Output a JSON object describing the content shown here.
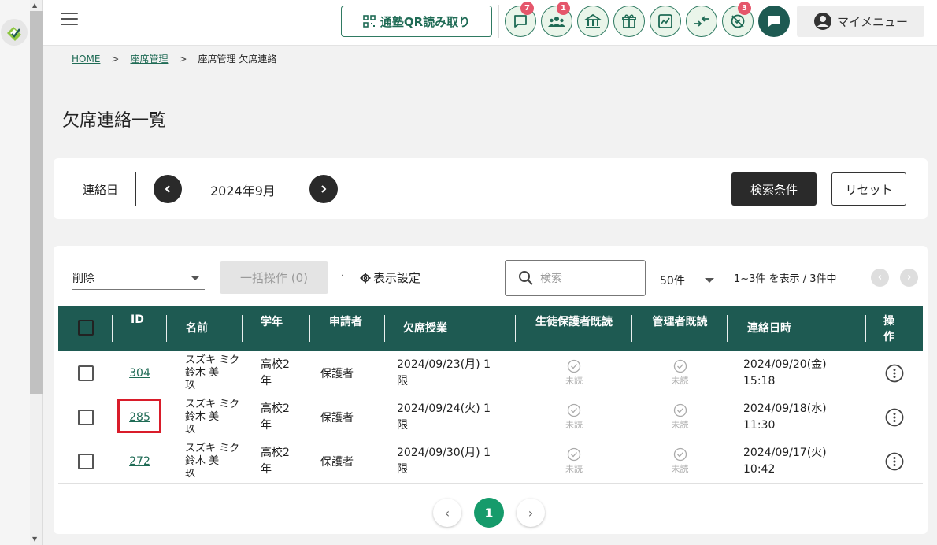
{
  "header": {
    "qr_label": "通塾QR読み取り",
    "badges": {
      "messages": "7",
      "students": "1",
      "alerts": "3"
    },
    "mymenu_label": "マイメニュー"
  },
  "breadcrumb": {
    "home": "HOME",
    "seat": "座席管理",
    "current": "座席管理 欠席連絡"
  },
  "page_title": "欠席連絡一覧",
  "filter": {
    "label": "連絡日",
    "month": "2024年9月",
    "search_condition_label": "検索条件",
    "reset_label": "リセット"
  },
  "toolbar": {
    "bulk_action_selected": "削除",
    "bulk_button_label": "一括操作 (0)",
    "display_settings_label": "表示設定",
    "search_placeholder": "検索",
    "per_page": "50件",
    "range_text": "1~3件 を表示 / 3件中"
  },
  "table": {
    "headers": {
      "id": "ID",
      "name": "名前",
      "grade": "学年",
      "applicant": "申請者",
      "absent_class": "欠席授業",
      "guardian_read": "生徒保護者既読",
      "admin_read": "管理者既読",
      "contact_datetime": "連絡日時",
      "actions": "操作"
    },
    "rows": [
      {
        "id": "304",
        "name_kana": "スズキ ミク",
        "name_line2": "鈴木 美",
        "name_line3": "玖",
        "grade_l1": "高校2",
        "grade_l2": "年",
        "applicant": "保護者",
        "class_l1": "2024/09/23(月) 1",
        "class_l2": "限",
        "guardian_read": "未読",
        "admin_read": "未読",
        "date_l1": "2024/09/20(金)",
        "date_l2": "15:18"
      },
      {
        "id": "285",
        "name_kana": "スズキ ミク",
        "name_line2": "鈴木 美",
        "name_line3": "玖",
        "grade_l1": "高校2",
        "grade_l2": "年",
        "applicant": "保護者",
        "class_l1": "2024/09/24(火) 1",
        "class_l2": "限",
        "guardian_read": "未読",
        "admin_read": "未読",
        "date_l1": "2024/09/18(水)",
        "date_l2": "11:30"
      },
      {
        "id": "272",
        "name_kana": "スズキ ミク",
        "name_line2": "鈴木 美",
        "name_line3": "玖",
        "grade_l1": "高校2",
        "grade_l2": "年",
        "applicant": "保護者",
        "class_l1": "2024/09/30(月) 1",
        "class_l2": "限",
        "guardian_read": "未読",
        "admin_read": "未読",
        "date_l1": "2024/09/17(火)",
        "date_l2": "10:42"
      }
    ]
  },
  "pagination": {
    "current_page": "1"
  },
  "colors": {
    "primary": "#1e5a52",
    "accent": "#169b6b",
    "badge": "#e5566b",
    "highlight": "#d91c2a"
  }
}
